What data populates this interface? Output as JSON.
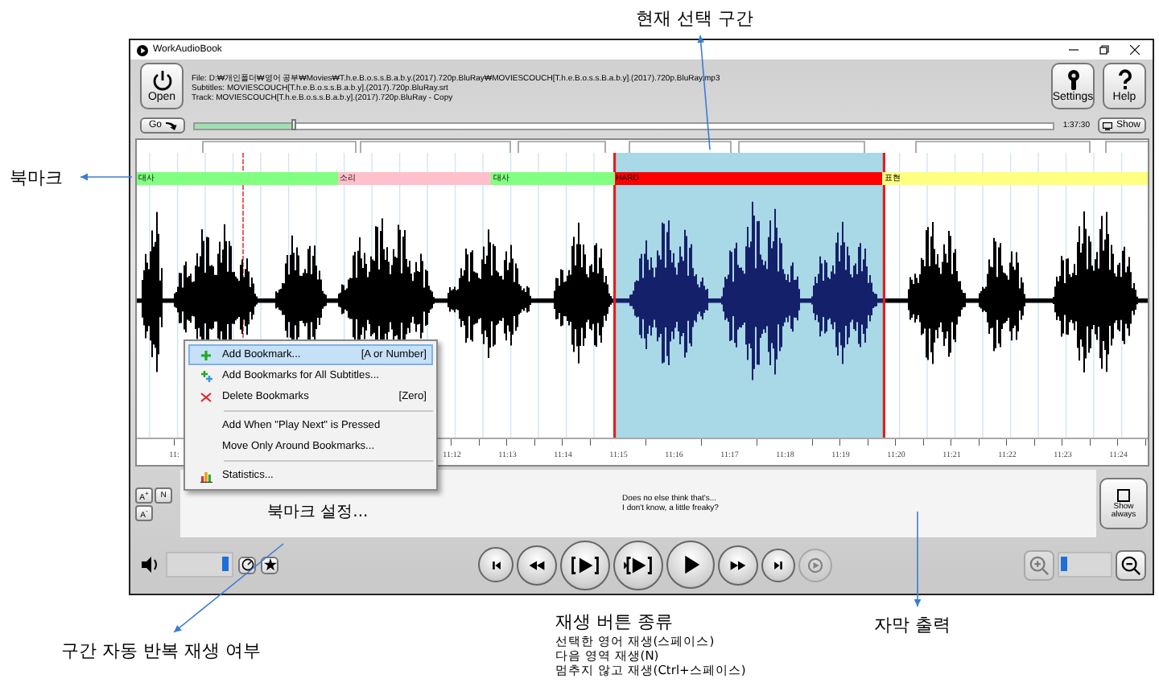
{
  "window": {
    "title": "WorkAudioBook"
  },
  "header": {
    "open_label": "Open",
    "file_lines": [
      "File: D:₩개인폴더₩영어 공부₩Movies₩T.h.e.B.o.s.s.B.a.b.y.(2017).720p.BluRay₩MOVIESCOUCH[T.h.e.B.o.s.s.B.a.b.y].(2017).720p.BluRay.mp3",
      "Subtitles:  MOVIESCOUCH[T.h.e.B.o.s.s.B.a.b.y].(2017).720p.BluRay.srt",
      "Track:  MOVIESCOUCH[T.h.e.B.o.s.s.B.a.b.y].(2017).720p.BluRay - Copy"
    ],
    "settings_label": "Settings",
    "help_label": "Help"
  },
  "position": {
    "go_label": "Go",
    "level": 0.115,
    "time": "1:37:30",
    "show_label": "Show"
  },
  "bookmarks": [
    {
      "label": "대사",
      "color": "#80ff80"
    },
    {
      "label": "소리",
      "color": "#ffc0cb"
    },
    {
      "label": "대사",
      "color": "#80ff80"
    },
    {
      "label": "HARD",
      "color": "#ff0000"
    },
    {
      "label": "표현",
      "color": "#ffff80"
    }
  ],
  "time_axis": [
    "11:",
    "11:12",
    "11:13",
    "11:14",
    "11:15",
    "11:16",
    "11:17",
    "11:18",
    "11:19",
    "11:20",
    "11:21",
    "11:22",
    "11:23",
    "11:24"
  ],
  "font_buttons": [
    "A$^{+}$",
    "N",
    "A$^{-}$"
  ],
  "subtitle": [
    "Does no else think that's...",
    "I don't know, a little freaky?"
  ],
  "show_always": {
    "label": "Show always",
    "checked": false
  },
  "volume": {
    "level": 0.9
  },
  "transport": [
    {
      "kind": "start",
      "disabled": false
    },
    {
      "kind": "rewind",
      "disabled": false
    },
    {
      "kind": "play-selection",
      "disabled": false
    },
    {
      "kind": "play-next",
      "disabled": false
    },
    {
      "kind": "play",
      "disabled": false
    },
    {
      "kind": "forward",
      "disabled": false
    },
    {
      "kind": "end",
      "disabled": false
    },
    {
      "kind": "continuous",
      "disabled": true
    }
  ],
  "zoom": {
    "level": 0.08,
    "zoom_in_disabled": true,
    "zoom_out_disabled": false
  },
  "context_menu": [
    {
      "kind": "item",
      "label": "Add Bookmark...",
      "shortcut": "[A or Number]",
      "selected": true
    },
    {
      "kind": "item",
      "label": "Add Bookmarks for All Subtitles...",
      "selected": false
    },
    {
      "kind": "item",
      "label": "Delete Bookmarks",
      "shortcut": "[Zero]",
      "selected": false
    },
    {
      "kind": "separator"
    },
    {
      "kind": "item",
      "label": "Add When \"Play Next\" is Pressed",
      "selected": false
    },
    {
      "kind": "item",
      "label": "Move Only Around Bookmarks...",
      "selected": false
    },
    {
      "kind": "separator"
    },
    {
      "kind": "item",
      "label": "Statistics...",
      "selected": false
    }
  ],
  "annotations": [
    {
      "text": "현재 선택 구간"
    },
    {
      "text": "북마크"
    },
    {
      "text": "북마크 설정..."
    },
    {
      "text": "구간 자동 반복 재생 여부"
    },
    {
      "text": "재생 버튼 종류",
      "notes": [
        "선택한 영어 재생(스페이스)",
        "다음 영역 재생(N)",
        "멈추지 않고 재생(Ctrl+스페이스)"
      ]
    },
    {
      "text": "자막 출력"
    }
  ]
}
